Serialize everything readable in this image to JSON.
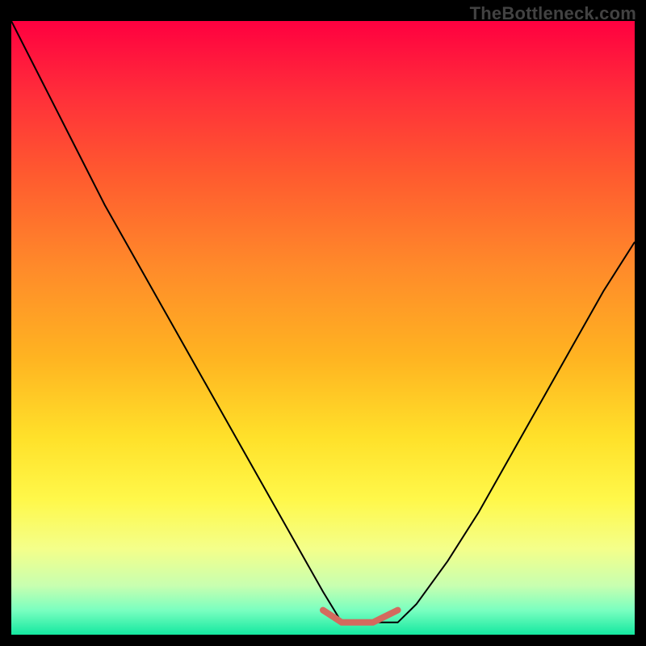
{
  "watermark": "TheBottleneck.com",
  "colors": {
    "page_bg": "#000000",
    "watermark": "#424242",
    "curve": "#000000",
    "highlight": "#d46a5e",
    "gradient_stops": [
      {
        "offset": 0.0,
        "hex": "#ff0040"
      },
      {
        "offset": 0.12,
        "hex": "#ff2e3a"
      },
      {
        "offset": 0.25,
        "hex": "#ff5a2f"
      },
      {
        "offset": 0.4,
        "hex": "#ff8a2a"
      },
      {
        "offset": 0.55,
        "hex": "#ffb421"
      },
      {
        "offset": 0.68,
        "hex": "#ffe12a"
      },
      {
        "offset": 0.78,
        "hex": "#fff84a"
      },
      {
        "offset": 0.86,
        "hex": "#f4ff8a"
      },
      {
        "offset": 0.92,
        "hex": "#c8ffb0"
      },
      {
        "offset": 0.96,
        "hex": "#7affc0"
      },
      {
        "offset": 1.0,
        "hex": "#14e8a0"
      }
    ]
  },
  "chart_data": {
    "type": "line",
    "title": "",
    "xlabel": "",
    "ylabel": "",
    "xlim": [
      0,
      1
    ],
    "ylim": [
      0,
      1
    ],
    "note": "No axes or tick labels are rendered; y=1 at top of gradient area, y=0 at bottom. x spans full width.",
    "series": [
      {
        "name": "bottleneck-curve",
        "x": [
          0.0,
          0.05,
          0.1,
          0.15,
          0.2,
          0.25,
          0.3,
          0.35,
          0.4,
          0.45,
          0.5,
          0.53,
          0.58,
          0.62,
          0.65,
          0.7,
          0.75,
          0.8,
          0.85,
          0.9,
          0.95,
          1.0
        ],
        "y": [
          1.0,
          0.9,
          0.8,
          0.7,
          0.61,
          0.52,
          0.43,
          0.34,
          0.25,
          0.16,
          0.07,
          0.02,
          0.02,
          0.02,
          0.05,
          0.12,
          0.2,
          0.29,
          0.38,
          0.47,
          0.56,
          0.64
        ]
      },
      {
        "name": "optimal-zone-highlight",
        "x": [
          0.5,
          0.53,
          0.58,
          0.62
        ],
        "y": [
          0.04,
          0.02,
          0.02,
          0.04
        ]
      }
    ]
  }
}
